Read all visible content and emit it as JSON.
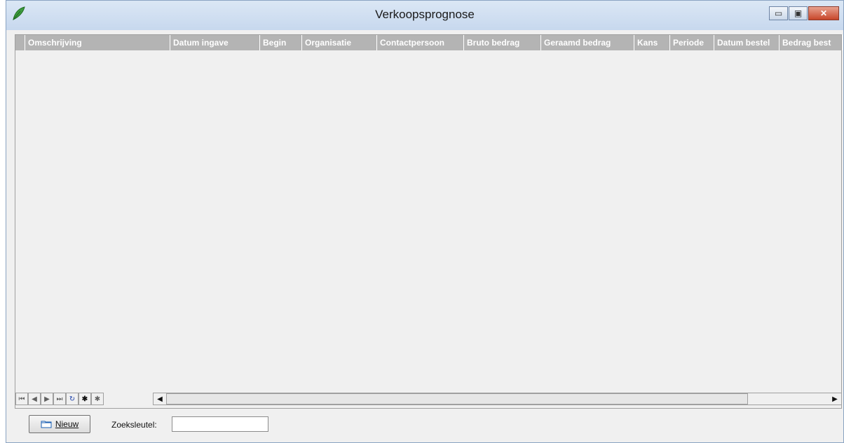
{
  "window": {
    "title": "Verkoopsprognose",
    "minimize_glyph": "▭",
    "maximize_glyph": "▣",
    "close_glyph": "✕"
  },
  "grid": {
    "columns": [
      "Omschrijving",
      "Datum ingave",
      "Begin",
      "Organisatie",
      "Contactpersoon",
      "Bruto bedrag",
      "Geraamd bedrag",
      "Kans",
      "Periode",
      "Datum bestel",
      "Bedrag best"
    ]
  },
  "navigator": {
    "first": "⏮",
    "prev": "◀",
    "next": "▶",
    "last": "⏭",
    "refresh": "↻",
    "insert": "✱",
    "insert2": "✱"
  },
  "scrollbar": {
    "left": "◀",
    "right": "▶"
  },
  "footer": {
    "new_button": "Nieuw",
    "search_label": "Zoeksleutel:",
    "search_value": ""
  }
}
